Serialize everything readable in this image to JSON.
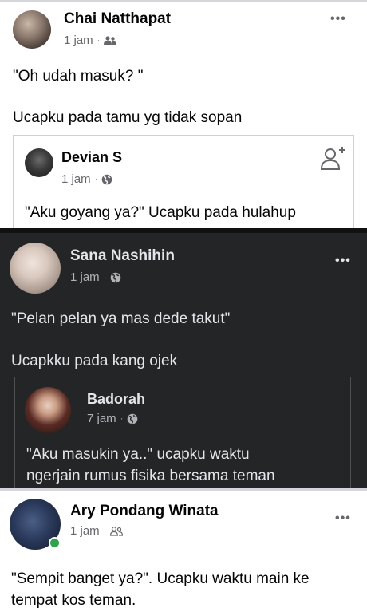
{
  "posts": [
    {
      "author": "Chai Natthapat",
      "time": "1 jam",
      "privacy_icon": "friends-icon",
      "line1": "\"Oh udah masuk? \"",
      "line2": "Ucapku pada tamu yg tidak sopan",
      "shared": {
        "author": "Devian S",
        "time": "1 jam",
        "privacy_icon": "globe-icon",
        "action_icon": "add-friend-icon",
        "text": "\"Aku goyang ya?\" Ucapku pada hulahup"
      }
    },
    {
      "author": "Sana Nashihin",
      "time": "1 jam",
      "privacy_icon": "globe-icon",
      "line1": "\"Pelan pelan ya mas dede takut\"",
      "line2": "Ucapkku pada kang ojek",
      "shared": {
        "author": "Badorah",
        "time": "7 jam",
        "privacy_icon": "globe-icon",
        "text_line1": "\"Aku masukin ya..\" ucapku waktu",
        "text_line2": "ngerjain  rumus fisika bersama teman"
      }
    },
    {
      "author": "Ary Pondang Winata",
      "time": "1 jam",
      "privacy_icon": "friends-icon",
      "line1": "\"Sempit banget ya?\". Ucapku waktu main ke",
      "line2": "tempat kos teman."
    }
  ],
  "meta_separator": "·",
  "more_glyph": "•••",
  "colors": {
    "light_bg": "#ffffff",
    "dark_bg": "#242526",
    "online": "#31a24c"
  }
}
